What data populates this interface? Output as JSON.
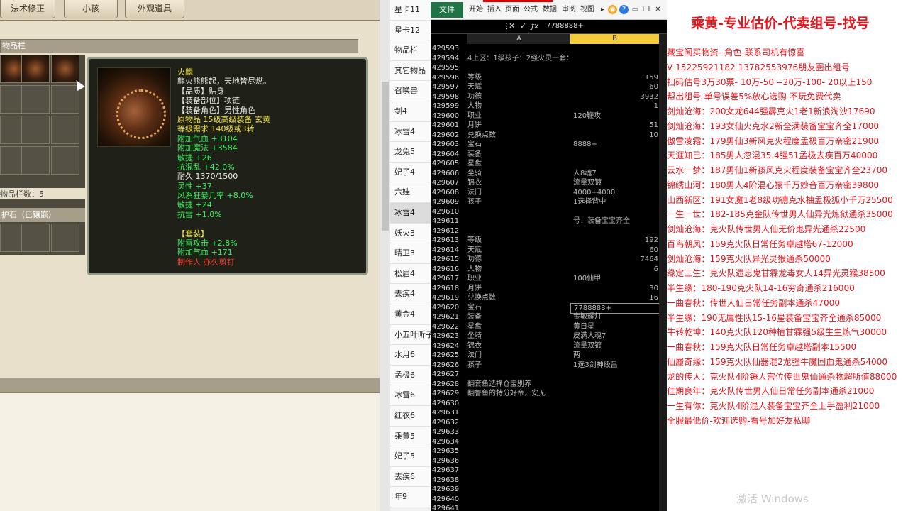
{
  "game": {
    "tabs": [
      "法术修正",
      "小孩",
      "外观道具"
    ],
    "inventory_header": "物品栏",
    "inventory_count": "物品栏数：5",
    "gem_bar": "护石（已镶嵌）",
    "tooltip": {
      "lines": [
        {
          "text": "火麟",
          "color": "yellow"
        },
        {
          "text": "麒火熊熊起，天地皆尽燃。",
          "color": "white"
        },
        {
          "text": "【品质】贴身",
          "color": "white"
        },
        {
          "text": "【装备部位】项链",
          "color": "white"
        },
        {
          "text": "【装备角色】男性角色",
          "color": "white"
        },
        {
          "text": "原物品 15级高级装备 玄黄",
          "color": "yellow"
        },
        {
          "text": "等级需求 140级或3转",
          "color": "yellow"
        },
        {
          "text": "附加气血 +3104",
          "color": "green"
        },
        {
          "text": "附加魔法 +3584",
          "color": "green"
        },
        {
          "text": "敏捷 +26",
          "color": "green"
        },
        {
          "text": "抗混乱 +42.0%",
          "color": "green"
        },
        {
          "text": "耐久 1370/1500",
          "color": "white"
        },
        {
          "text": "灵性 +37",
          "color": "green"
        },
        {
          "text": "风系狂暴几率 +8.0%",
          "color": "green"
        },
        {
          "text": "敏捷 +24",
          "color": "green"
        },
        {
          "text": "抗雷 +1.0%",
          "color": "green"
        },
        {
          "text": "",
          "color": "white"
        },
        {
          "text": "【套装】",
          "color": "yellow"
        },
        {
          "text": "附雷攻击 +2.8%",
          "color": "green"
        },
        {
          "text": "附加气血 +171",
          "color": "green"
        },
        {
          "text": "制作人 亦久剪钉",
          "color": "red"
        }
      ]
    }
  },
  "sheet_tabs": [
    "星卡11",
    "星卡12",
    "物品栏",
    "其它物品",
    "召唤兽",
    "剑4",
    "冰雪4",
    "龙兔5",
    "妃子4",
    "六娃",
    "冰雪4",
    "妖火3",
    "晴卫3",
    "松眉4",
    "去疾4",
    "黄金4",
    "小五叶昕子",
    "水月6",
    "孟极6",
    "冰雪6",
    "红衣6",
    "乘黄5",
    "妃子5",
    "去疾6",
    "年9"
  ],
  "active_sheet_index": 10,
  "excel": {
    "ribbon_file": "文件",
    "ribbon_tabs": [
      "开始",
      "插入",
      "页面",
      "公式",
      "数据",
      "审阅",
      "视图"
    ],
    "formula_value": "7788888+",
    "col_a": "A",
    "col_b": "B",
    "rows": [
      {
        "n": "429593",
        "a": "",
        "b": ""
      },
      {
        "n": "429594",
        "a": "4上区：1级孩子：2强火灵一套：敏捷克水一套",
        "b": ""
      },
      {
        "n": "429595",
        "a": "",
        "b": ""
      },
      {
        "n": "429596",
        "a": "等级",
        "b": "159"
      },
      {
        "n": "429597",
        "a": "天赋",
        "b": "60"
      },
      {
        "n": "429598",
        "a": "功德",
        "b": "3932"
      },
      {
        "n": "429599",
        "a": "人物",
        "b": "1"
      },
      {
        "n": "429600",
        "a": "职业",
        "b": "120鞭攻",
        "bl": true
      },
      {
        "n": "429601",
        "a": "月饼",
        "b": "51"
      },
      {
        "n": "429602",
        "a": "兑换点数",
        "b": "10"
      },
      {
        "n": "429603",
        "a": "宝石",
        "b": "8888+",
        "bl": true
      },
      {
        "n": "429604",
        "a": "装备",
        "b": ""
      },
      {
        "n": "429605",
        "a": "星盘",
        "b": ""
      },
      {
        "n": "429606",
        "a": "坐骑",
        "b": "人8魂7",
        "bl": true
      },
      {
        "n": "429607",
        "a": "锦衣",
        "b": "流量双镀",
        "bl": true
      },
      {
        "n": "429608",
        "a": "法门",
        "b": "4000+4000",
        "bl": true
      },
      {
        "n": "429609",
        "a": "孩子",
        "b": "1选择背中",
        "bl": true
      },
      {
        "n": "429610",
        "a": "",
        "b": ""
      },
      {
        "n": "429611",
        "a": "",
        "b": "号：装备宝宝齐全",
        "bl": true
      },
      {
        "n": "429612",
        "a": "",
        "b": ""
      },
      {
        "n": "429613",
        "a": "等级",
        "b": "192"
      },
      {
        "n": "429614",
        "a": "天赋",
        "b": "60"
      },
      {
        "n": "429615",
        "a": "功德",
        "b": "7464"
      },
      {
        "n": "429616",
        "a": "人物",
        "b": "6"
      },
      {
        "n": "429617",
        "a": "职业",
        "b": "100仙甲",
        "bl": true
      },
      {
        "n": "429618",
        "a": "月饼",
        "b": "30"
      },
      {
        "n": "429619",
        "a": "兑换点数",
        "b": "16"
      },
      {
        "n": "429620",
        "a": "宝石",
        "b": "7788888+",
        "bl": true,
        "sel": true
      },
      {
        "n": "429621",
        "a": "装备",
        "b": "金敏耀灯",
        "bl": true
      },
      {
        "n": "429622",
        "a": "星盘",
        "b": "黄日星",
        "bl": true
      },
      {
        "n": "429623",
        "a": "坐骑",
        "b": "皮满人魂7",
        "bl": true
      },
      {
        "n": "429624",
        "a": "锦衣",
        "b": "流量双镀",
        "bl": true
      },
      {
        "n": "429625",
        "a": "法门",
        "b": "两",
        "bl": true
      },
      {
        "n": "429626",
        "a": "孩子",
        "b": "1选3剑神级吕",
        "bl": true
      },
      {
        "n": "429627",
        "a": "",
        "b": ""
      },
      {
        "n": "429628",
        "a": "翻套鱼选择仓宝别养",
        "b": ""
      },
      {
        "n": "429629",
        "a": "翻鲁鱼的特分好帝，安无",
        "b": ""
      },
      {
        "n": "429630",
        "a": "",
        "b": ""
      },
      {
        "n": "429631",
        "a": "",
        "b": ""
      },
      {
        "n": "429632",
        "a": "",
        "b": ""
      },
      {
        "n": "429633",
        "a": "",
        "b": ""
      },
      {
        "n": "429634",
        "a": "",
        "b": ""
      },
      {
        "n": "429635",
        "a": "",
        "b": ""
      },
      {
        "n": "429636",
        "a": "",
        "b": ""
      },
      {
        "n": "429637",
        "a": "",
        "b": ""
      },
      {
        "n": "429638",
        "a": "",
        "b": ""
      },
      {
        "n": "429639",
        "a": "",
        "b": ""
      },
      {
        "n": "429640",
        "a": "",
        "b": ""
      },
      {
        "n": "429641",
        "a": "",
        "b": ""
      }
    ]
  },
  "ads": {
    "title": "乘黄-专业估价-代卖组号-找号",
    "lines": [
      "藏宝阁买物资--角色-联系司机有惊喜",
      "V 15225921182  13782553976朋友圈出组号",
      "扫码估号3万30票- 10万-50 --20万-100- 20以上150",
      "帮出组号-单号误差5%放心选购-不玩免费代卖",
      "剑灿沧海：200女龙644强霹克火1老1新浪淘沙17690",
      "剑灿沧海：193女仙火克水2新全满装备宝宝齐全17000",
      "傲雪凌霜：179男仙3新风克火程度孟极百万亲密21900",
      "天涯知己：185男人忽混35.4强51孟极去疾百万40000",
      "云水一梦：187男仙1新孩风克火程度装备宝宝齐全23700",
      "锦绣山河：180男人4阶混心猿千万妙音百万亲密39800",
      "山西新区：191女魔1老8级功德克水抽孟极狐小千万25500",
      "一生一世：182-185克金队传世男人仙异光炼狱通杀35000",
      "剑灿沧海：克火队传世男人仙无价鬼异光通杀22500",
      "百鸟朝凤：159克火队日常任务卓越塔67-12000",
      "剑灿沧海：159克火队异光灵猴通杀50000",
      "缘定三生：克火队遗忘鬼甘霖龙毒女人14异光灵猴38500",
      "半生缘：180-190克火队14-16穷奇通杀216000",
      "一曲春秋：传世人仙日常任务副本通杀47000",
      "半生缘：190无属性队15-16星装备宝宝齐全通杀85000",
      "牛转乾坤：140克火队120种植甘霖强5级生生炼气30000",
      "一曲春秋：159克火队日常任务卓越塔副本15500",
      "仙履奇缘：159克火队仙器混2龙强牛魔回血鬼通杀54000",
      "龙的传人：克火队4阶锤人宫位传世鬼仙通杀物超所值88000",
      "佳期良年：克火队传世男人仙日常任务副本通杀21000",
      "一生有你：克火队4阶混人装备宝宝齐全上手盈利21000",
      "全服最低价-欢迎选购-看号加好友私聊"
    ],
    "watermark": "激活 Windows"
  }
}
